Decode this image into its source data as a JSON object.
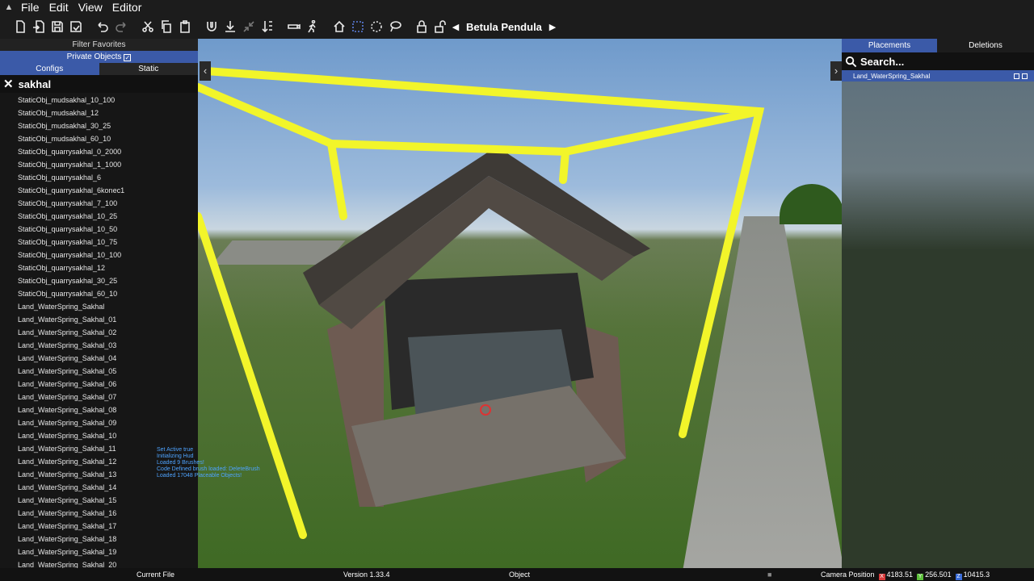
{
  "menu": {
    "items": [
      "File",
      "Edit",
      "View",
      "Editor"
    ]
  },
  "toolbar": {
    "brush_name": "Betula Pendula"
  },
  "left_panel": {
    "filter_favorites": "Filter Favorites",
    "private_objects": "Private Objects",
    "private_checked": "✓",
    "tabs": {
      "configs": "Configs",
      "static": "Static"
    },
    "search_value": "sakhal",
    "items": [
      "StaticObj_mudsakhal_10_100",
      "StaticObj_mudsakhal_12",
      "StaticObj_mudsakhal_30_25",
      "StaticObj_mudsakhal_60_10",
      "StaticObj_quarrysakhal_0_2000",
      "StaticObj_quarrysakhal_1_1000",
      "StaticObj_quarrysakhal_6",
      "StaticObj_quarrysakhal_6konec1",
      "StaticObj_quarrysakhal_7_100",
      "StaticObj_quarrysakhal_10_25",
      "StaticObj_quarrysakhal_10_50",
      "StaticObj_quarrysakhal_10_75",
      "StaticObj_quarrysakhal_10_100",
      "StaticObj_quarrysakhal_12",
      "StaticObj_quarrysakhal_30_25",
      "StaticObj_quarrysakhal_60_10",
      "Land_WaterSpring_Sakhal",
      "Land_WaterSpring_Sakhal_01",
      "Land_WaterSpring_Sakhal_02",
      "Land_WaterSpring_Sakhal_03",
      "Land_WaterSpring_Sakhal_04",
      "Land_WaterSpring_Sakhal_05",
      "Land_WaterSpring_Sakhal_06",
      "Land_WaterSpring_Sakhal_07",
      "Land_WaterSpring_Sakhal_08",
      "Land_WaterSpring_Sakhal_09",
      "Land_WaterSpring_Sakhal_10",
      "Land_WaterSpring_Sakhal_11",
      "Land_WaterSpring_Sakhal_12",
      "Land_WaterSpring_Sakhal_13",
      "Land_WaterSpring_Sakhal_14",
      "Land_WaterSpring_Sakhal_15",
      "Land_WaterSpring_Sakhal_16",
      "Land_WaterSpring_Sakhal_17",
      "Land_WaterSpring_Sakhal_18",
      "Land_WaterSpring_Sakhal_19",
      "Land_WaterSpring_Sakhal_20"
    ]
  },
  "console": [
    "Set Active true",
    "Initializing Hud",
    "Loaded 9 Brushes!",
    "Code Defined brush loaded: DeleteBrush",
    "Loaded 17048 Placeable Objects!"
  ],
  "right_panel": {
    "tabs": {
      "placements": "Placements",
      "deletions": "Deletions"
    },
    "search_placeholder": "Search...",
    "placements": [
      "Land_WaterSpring_Sakhal"
    ]
  },
  "status": {
    "current_file": "Current File",
    "version": "Version 1.33.4",
    "object": "Object",
    "camera_label": "Camera Position",
    "cam_x": "4183.51",
    "cam_y": "256.501",
    "cam_z": "10415.3",
    "axis_x": "X",
    "axis_y": "Y",
    "axis_z": "Z"
  },
  "colors": {
    "accent": "#3b5aa8",
    "selection_box": "#f2f52a",
    "axis_x": "#d83a3a",
    "axis_y": "#5cbf3a",
    "axis_z": "#3a6cd8"
  }
}
